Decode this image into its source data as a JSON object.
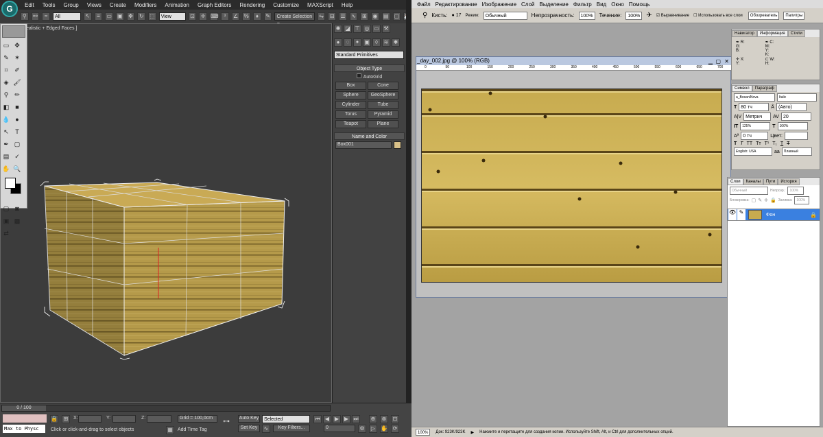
{
  "max": {
    "menu": [
      "Edit",
      "Tools",
      "Group",
      "Views",
      "Create",
      "Modifiers",
      "Animation",
      "Graph Editors",
      "Rendering",
      "Customize",
      "MAXScript",
      "Help"
    ],
    "filter_dropdown": "All",
    "view_dropdown": "View",
    "selection_set": "Create Selection Se",
    "viewport_label": "ective | [ Realistic + Edged Faces ]",
    "cmd": {
      "category": "Standard Primitives",
      "object_type_header": "Object Type",
      "autogrid": "AutoGrid",
      "buttons": [
        "Box",
        "Cone",
        "Sphere",
        "GeoSphere",
        "Cylinder",
        "Tube",
        "Torus",
        "Pyramid",
        "Teapot",
        "Plane"
      ],
      "name_color_header": "Name and Color",
      "object_name": "Box001",
      "object_color": "#d8c088"
    },
    "bottom": {
      "time": "0 / 100",
      "script_label": "Max to Physc",
      "x_label": "X:",
      "y_label": "Y:",
      "z_label": "Z:",
      "grid": "Grid = 100,0cm",
      "auto_key": "Auto Key",
      "selected": "Selected",
      "set_key": "Set Key",
      "key_filters": "Key Filters...",
      "frame": "0",
      "status": "Click or click-and-drag to select objects",
      "add_time_tag": "Add Time Tag"
    }
  },
  "ps": {
    "menu": [
      "Файл",
      "Редактирование",
      "Изображение",
      "Слой",
      "Выделение",
      "Фильтр",
      "Вид",
      "Окно",
      "Помощь"
    ],
    "options": {
      "brush_label": "Кисть:",
      "brush_size": "17",
      "mode_label": "Режим:",
      "mode": "Обычный",
      "opacity_label": "Непрозрачность:",
      "opacity": "100%",
      "flow_label": "Течение:",
      "flow": "100%",
      "smoothing": "Выравнивание",
      "all_layers": "Использовать все слои",
      "browser_btn": "Обозреватель",
      "palettes_btn": "Палитры"
    },
    "doc_title": "_day_002.jpg @ 100% (RGB)",
    "ruler_ticks": [
      "0",
      "50",
      "100",
      "150",
      "200",
      "250",
      "300",
      "350",
      "400",
      "450",
      "500",
      "550",
      "600",
      "650",
      "700"
    ],
    "info_panel": {
      "tabs": [
        "Навигатор",
        "Информация",
        "Стили"
      ],
      "labels": [
        "R:",
        "G:",
        "B:",
        "C:",
        "M:",
        "Y:",
        "K:",
        "X:",
        "Y:",
        "W:",
        "H:"
      ]
    },
    "char_panel": {
      "tabs": [
        "Символ",
        "Параграф"
      ],
      "font": "a_BosaniNova",
      "style": "Italic",
      "size": "80 тч",
      "leading": "(Авто)",
      "kerning": "Метрич",
      "tracking": "20",
      "vscale": "125%",
      "hscale": "100%",
      "baseline": "0 тч",
      "color_label": "Цвет:",
      "lang": "English: USA",
      "aa": "Плавный",
      "styles": [
        "T",
        "T",
        "TT",
        "Tт",
        "T¹",
        "T₁",
        "T",
        "T"
      ]
    },
    "layers_panel": {
      "tabs": [
        "Слои",
        "Каналы",
        "Пути",
        "История"
      ],
      "blend": "Обычный",
      "opacity_label": "Непрозр.:",
      "opacity": "100%",
      "lock_label": "Блокировка:",
      "fill_label": "Заливка:",
      "fill": "100%",
      "layer_name": "Фон"
    },
    "status": {
      "zoom": "100%",
      "doc": "Док: 923K/923K",
      "hint": "Нажмите и перетащите для создания копии. Используйте Shift, Alt, и Ctrl для дополнительных опций."
    }
  }
}
